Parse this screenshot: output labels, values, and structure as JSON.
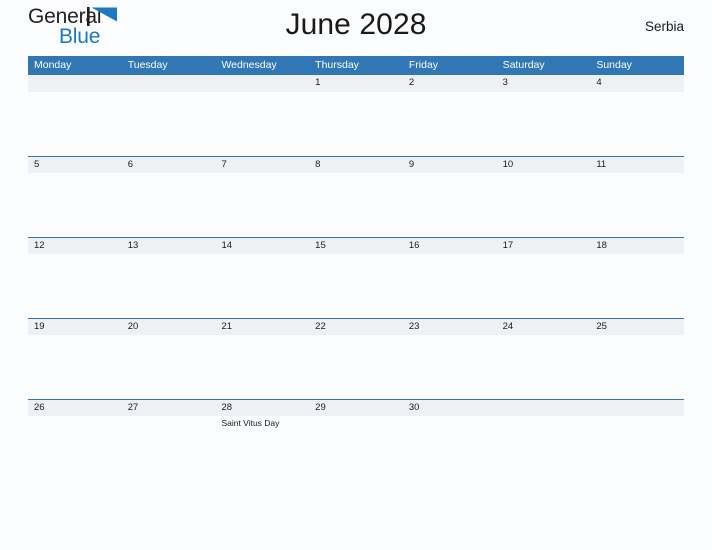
{
  "brand": {
    "name_part1": "General",
    "name_part2": "Blue",
    "flag_icon": "flag-triangle-icon",
    "accent_color": "#1f77c2"
  },
  "header": {
    "title": "June 2028",
    "region": "Serbia"
  },
  "theme": {
    "header_blue": "#3176b5",
    "band_gray": "#eff0f1",
    "page_background": "#fbfcfd",
    "text_color": "#1a1a1a"
  },
  "calendar": {
    "month": "June",
    "year": "2028",
    "weekday_headers": [
      "Monday",
      "Tuesday",
      "Wednesday",
      "Thursday",
      "Friday",
      "Saturday",
      "Sunday"
    ],
    "weeks": [
      [
        {
          "day": "",
          "events": []
        },
        {
          "day": "",
          "events": []
        },
        {
          "day": "",
          "events": []
        },
        {
          "day": "1",
          "events": []
        },
        {
          "day": "2",
          "events": []
        },
        {
          "day": "3",
          "events": []
        },
        {
          "day": "4",
          "events": []
        }
      ],
      [
        {
          "day": "5",
          "events": []
        },
        {
          "day": "6",
          "events": []
        },
        {
          "day": "7",
          "events": []
        },
        {
          "day": "8",
          "events": []
        },
        {
          "day": "9",
          "events": []
        },
        {
          "day": "10",
          "events": []
        },
        {
          "day": "11",
          "events": []
        }
      ],
      [
        {
          "day": "12",
          "events": []
        },
        {
          "day": "13",
          "events": []
        },
        {
          "day": "14",
          "events": []
        },
        {
          "day": "15",
          "events": []
        },
        {
          "day": "16",
          "events": []
        },
        {
          "day": "17",
          "events": []
        },
        {
          "day": "18",
          "events": []
        }
      ],
      [
        {
          "day": "19",
          "events": []
        },
        {
          "day": "20",
          "events": []
        },
        {
          "day": "21",
          "events": []
        },
        {
          "day": "22",
          "events": []
        },
        {
          "day": "23",
          "events": []
        },
        {
          "day": "24",
          "events": []
        },
        {
          "day": "25",
          "events": []
        }
      ],
      [
        {
          "day": "26",
          "events": []
        },
        {
          "day": "27",
          "events": []
        },
        {
          "day": "28",
          "events": [
            "Saint Vitus Day"
          ]
        },
        {
          "day": "29",
          "events": []
        },
        {
          "day": "30",
          "events": []
        },
        {
          "day": "",
          "events": []
        },
        {
          "day": "",
          "events": []
        }
      ]
    ]
  }
}
